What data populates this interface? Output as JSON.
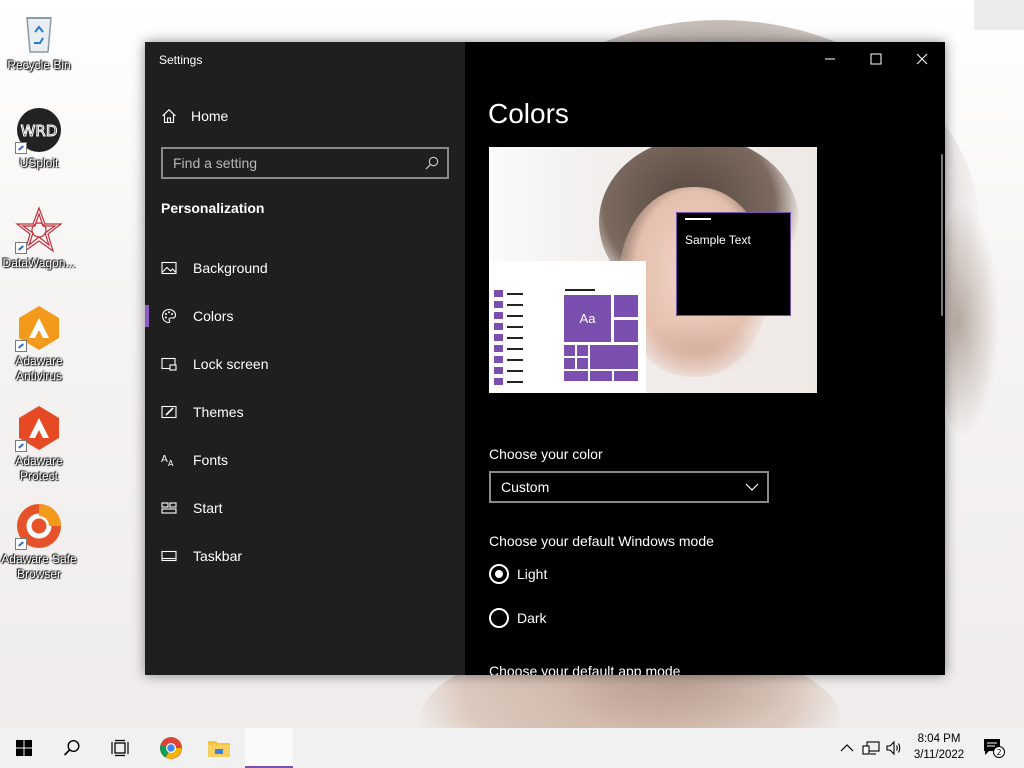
{
  "desktop": {
    "icons": [
      {
        "label": "Recycle Bin"
      },
      {
        "label": "USploit",
        "icon_text": "WRD"
      },
      {
        "label": "DataWagon..."
      },
      {
        "label": "Adaware Antivirus"
      },
      {
        "label": "Adaware Protect"
      },
      {
        "label": "Adaware Safe Browser"
      }
    ]
  },
  "window": {
    "title": "Settings",
    "sidebar": {
      "home_label": "Home",
      "search_placeholder": "Find a setting",
      "section_heading": "Personalization",
      "items": [
        {
          "label": "Background",
          "icon": "picture-icon"
        },
        {
          "label": "Colors",
          "icon": "palette-icon",
          "active": true
        },
        {
          "label": "Lock screen",
          "icon": "lock-screen-icon"
        },
        {
          "label": "Themes",
          "icon": "brush-icon"
        },
        {
          "label": "Fonts",
          "icon": "font-icon"
        },
        {
          "label": "Start",
          "icon": "start-tiles-icon"
        },
        {
          "label": "Taskbar",
          "icon": "taskbar-icon"
        }
      ]
    },
    "content": {
      "page_title": "Colors",
      "preview": {
        "sample_text": "Sample Text",
        "tile_text": "Aa"
      },
      "choose_color_label": "Choose your color",
      "choose_color_value": "Custom",
      "windows_mode_label": "Choose your default Windows mode",
      "windows_mode_options": [
        {
          "label": "Light",
          "selected": true
        },
        {
          "label": "Dark",
          "selected": false
        }
      ],
      "app_mode_label": "Choose your default app mode"
    }
  },
  "taskbar": {
    "clock_time": "8:04 PM",
    "clock_date": "3/11/2022",
    "notification_count": "2"
  },
  "colors": {
    "accent": "#7b4fb0",
    "sidebar_bg": "#1f1f1f",
    "content_bg": "#000000",
    "taskbar_bg": "#f1f1f1"
  }
}
